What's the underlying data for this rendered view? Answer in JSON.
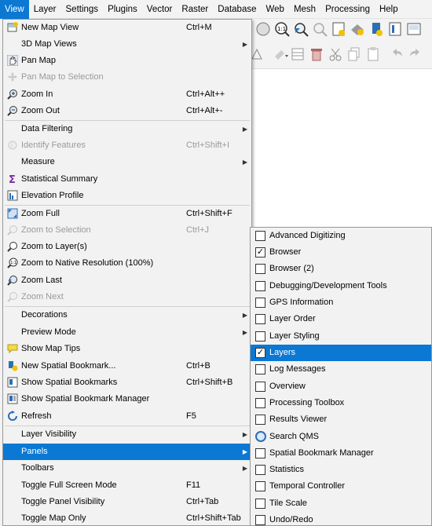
{
  "menubar": {
    "items": [
      "View",
      "Layer",
      "Settings",
      "Plugins",
      "Vector",
      "Raster",
      "Database",
      "Web",
      "Mesh",
      "Processing",
      "Help"
    ]
  },
  "view_menu": {
    "items": [
      {
        "label": "New Map View",
        "shortcut": "Ctrl+M",
        "icon": "new-map-view-icon"
      },
      {
        "label": "3D Map Views",
        "submenu": true
      },
      {
        "label": "Pan Map",
        "icon": "pan-hand-icon"
      },
      {
        "label": "Pan Map to Selection",
        "disabled": true,
        "icon": "pan-selection-icon"
      },
      {
        "label": "Zoom In",
        "shortcut": "Ctrl+Alt++",
        "icon": "zoom-in-icon"
      },
      {
        "label": "Zoom Out",
        "shortcut": "Ctrl+Alt+-",
        "icon": "zoom-out-icon"
      },
      {
        "label": "Data Filtering",
        "submenu": true
      },
      {
        "label": "Identify Features",
        "shortcut": "Ctrl+Shift+I",
        "disabled": true,
        "icon": "identify-icon"
      },
      {
        "label": "Measure",
        "submenu": true
      },
      {
        "label": "Statistical Summary",
        "icon": "sigma-icon"
      },
      {
        "label": "Elevation Profile",
        "icon": "elevation-profile-icon"
      },
      {
        "label": "Zoom Full",
        "shortcut": "Ctrl+Shift+F",
        "icon": "zoom-full-icon"
      },
      {
        "label": "Zoom to Selection",
        "shortcut": "Ctrl+J",
        "disabled": true,
        "icon": "zoom-selection-icon"
      },
      {
        "label": "Zoom to Layer(s)",
        "icon": "zoom-layer-icon"
      },
      {
        "label": "Zoom to Native Resolution (100%)",
        "icon": "zoom-native-icon"
      },
      {
        "label": "Zoom Last",
        "icon": "zoom-last-icon"
      },
      {
        "label": "Zoom Next",
        "disabled": true,
        "icon": "zoom-next-icon"
      },
      {
        "label": "Decorations",
        "submenu": true
      },
      {
        "label": "Preview Mode",
        "submenu": true
      },
      {
        "label": "Show Map Tips",
        "icon": "map-tips-icon"
      },
      {
        "label": "New Spatial Bookmark...",
        "shortcut": "Ctrl+B",
        "icon": "new-bookmark-icon"
      },
      {
        "label": "Show Spatial Bookmarks",
        "shortcut": "Ctrl+Shift+B",
        "icon": "show-bookmarks-icon"
      },
      {
        "label": "Show Spatial Bookmark Manager",
        "icon": "bookmark-manager-icon"
      },
      {
        "label": "Refresh",
        "shortcut": "F5",
        "icon": "refresh-icon"
      },
      {
        "label": "Layer Visibility",
        "submenu": true
      },
      {
        "label": "Panels",
        "submenu": true,
        "highlight": true
      },
      {
        "label": "Toolbars",
        "submenu": true
      },
      {
        "label": "Toggle Full Screen Mode",
        "shortcut": "F11"
      },
      {
        "label": "Toggle Panel Visibility",
        "shortcut": "Ctrl+Tab"
      },
      {
        "label": "Toggle Map Only",
        "shortcut": "Ctrl+Shift+Tab"
      }
    ]
  },
  "panels_menu": {
    "items": [
      {
        "label": "Advanced Digitizing",
        "checked": false
      },
      {
        "label": "Browser",
        "checked": true
      },
      {
        "label": "Browser (2)",
        "checked": false
      },
      {
        "label": "Debugging/Development Tools",
        "checked": false
      },
      {
        "label": "GPS Information",
        "checked": false
      },
      {
        "label": "Layer Order",
        "checked": false
      },
      {
        "label": "Layer Styling",
        "checked": false
      },
      {
        "label": "Layers",
        "checked": true,
        "highlight": true
      },
      {
        "label": "Log Messages",
        "checked": false
      },
      {
        "label": "Overview",
        "checked": false
      },
      {
        "label": "Processing Toolbox",
        "checked": false
      },
      {
        "label": "Results Viewer",
        "checked": false
      },
      {
        "label": "Search QMS",
        "icon": "search-qms-icon"
      },
      {
        "label": "Spatial Bookmark Manager",
        "checked": false
      },
      {
        "label": "Statistics",
        "checked": false
      },
      {
        "label": "Temporal Controller",
        "checked": false
      },
      {
        "label": "Tile Scale",
        "checked": false
      },
      {
        "label": "Undo/Redo",
        "checked": false
      }
    ]
  },
  "colors": {
    "highlight": "#0b78d4",
    "menu_bg": "#f2f2f2"
  }
}
